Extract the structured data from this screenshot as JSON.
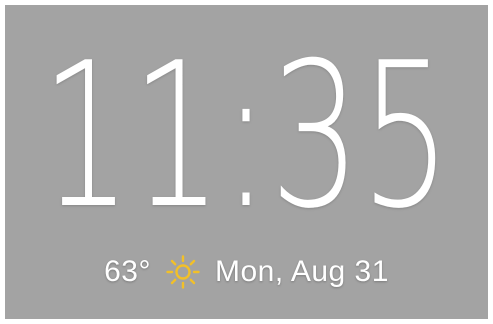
{
  "clock": {
    "time": "11:35"
  },
  "weather": {
    "temperature": "63°",
    "icon": "sun-icon",
    "icon_color": "#f2c028"
  },
  "date": {
    "label": "Mon, Aug 31"
  },
  "colors": {
    "background": "#a3a3a3",
    "text": "#ffffff"
  }
}
